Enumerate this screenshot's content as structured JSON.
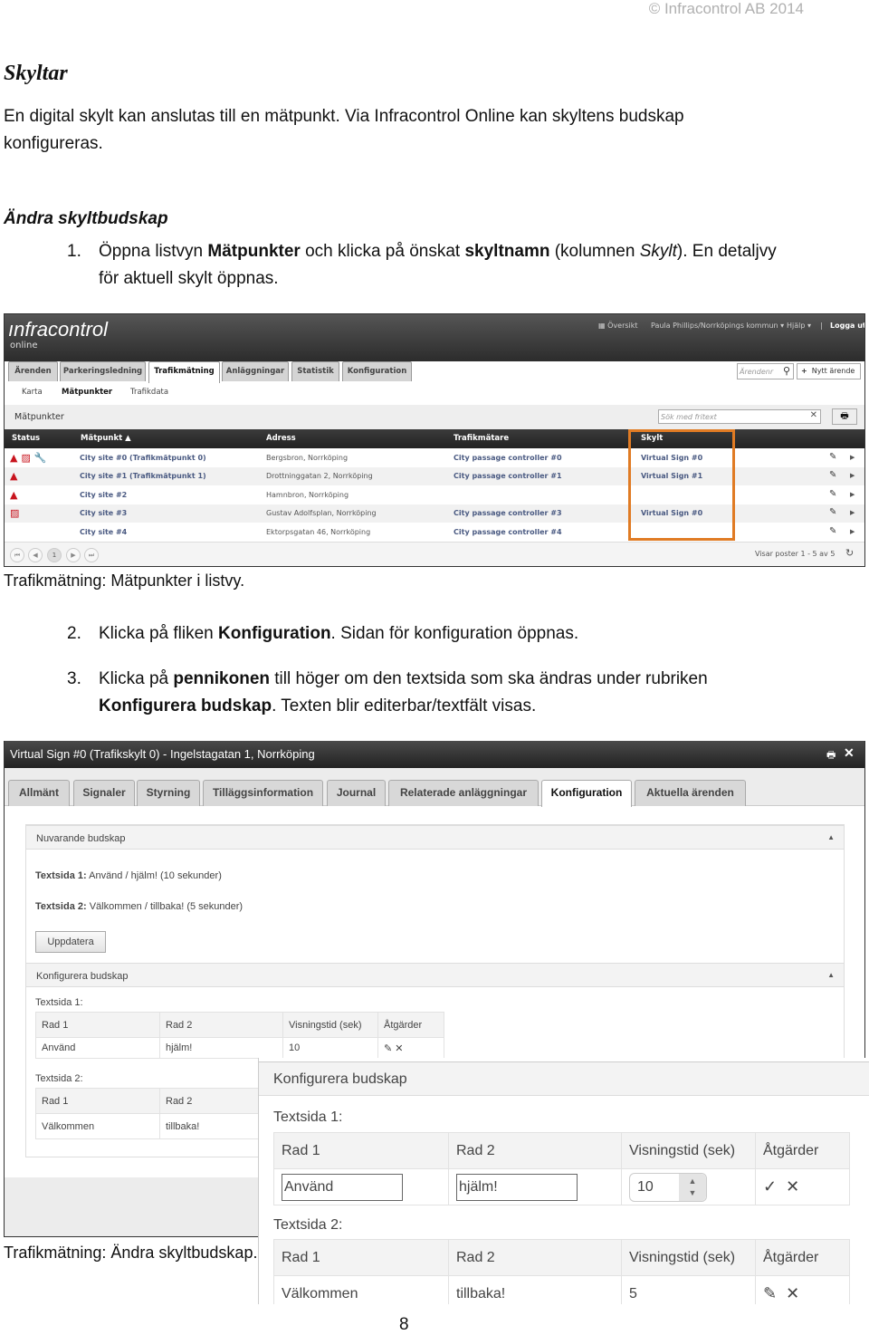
{
  "header": {
    "copyright": "© Infracontrol AB 2014"
  },
  "title": "Skyltar",
  "intro_1": "En digital skylt kan anslutas till en mätpunkt. Via Infracontrol Online kan skyltens budskap",
  "intro_2": "konfigureras.",
  "section_title": "Ändra skyltbudskap",
  "steps": [
    {
      "num": "1.",
      "a": "Öppna listvyn ",
      "b": "Mätpunkter",
      "c": " och klicka på önskat ",
      "d": "skyltnamn",
      "e": " (kolumnen ",
      "f": "Skylt",
      "g": "). En detaljvy",
      "line2": "för aktuell skylt öppnas."
    },
    {
      "num": "2.",
      "a": "Klicka på fliken ",
      "b": "Konfiguration",
      "c": ". Sidan för konfiguration öppnas."
    },
    {
      "num": "3.",
      "a": "Klicka på ",
      "b": "pennikonen",
      "c": " till höger om den textsida som ska ändras under rubriken",
      "d": "Konfigurera budskap",
      "e": ". Texten blir editerbar/textfält visas."
    }
  ],
  "caption_1": "Trafikmätning: Mätpunkter i listvy.",
  "caption_2": "Trafikmätning: Ändra skyltbudskap.",
  "page_number": "8",
  "app1": {
    "logo": "ınfracontrol",
    "logo_sub": "online",
    "top_links": {
      "overview": "Översikt",
      "user": "Paula Phillips/Norrköpings kommun ▾",
      "help": "Hjälp ▾",
      "sep": "|",
      "logout": "Logga ut"
    },
    "tabs": [
      "Ärenden",
      "Parkeringsledning",
      "Trafikmätning",
      "Anläggningar",
      "Statistik",
      "Konfiguration"
    ],
    "active_tab": "Trafikmätning",
    "case_search_placeholder": "Ärendenr",
    "new_case": "Nytt ärende",
    "subnav": [
      "Karta",
      "Mätpunkter",
      "Trafikdata"
    ],
    "panel_title": "Mätpunkter",
    "search_placeholder": "Sök med fritext",
    "columns": [
      "Status",
      "Mätpunkt ▲",
      "Adress",
      "Trafikmätare",
      "Skylt"
    ],
    "rows": [
      {
        "status": [
          "alarm",
          "fault",
          "service"
        ],
        "matpunkt": "City site #0 (Trafikmätpunkt 0)",
        "adress": "Bergsbron, Norrköping",
        "trafikmatare": "City passage controller #0",
        "skylt": "Virtual Sign #0"
      },
      {
        "status": [
          "alarm"
        ],
        "matpunkt": "City site #1 (Trafikmätpunkt 1)",
        "adress": "Drottninggatan 2, Norrköping",
        "trafikmatare": "City passage controller #1",
        "skylt": "Virtual Sign #1"
      },
      {
        "status": [
          "alarm"
        ],
        "matpunkt": "City site #2",
        "adress": "Hamnbron, Norrköping",
        "trafikmatare": "",
        "skylt": ""
      },
      {
        "status": [
          "fault"
        ],
        "matpunkt": "City site #3",
        "adress": "Gustav Adolfsplan, Norrköping",
        "trafikmatare": "City passage controller #3",
        "skylt": "Virtual Sign #0"
      },
      {
        "status": [],
        "matpunkt": "City site #4",
        "adress": "Ektorpsgatan 46, Norrköping",
        "trafikmatare": "City passage controller #4",
        "skylt": ""
      }
    ],
    "pager": {
      "first": "⏮",
      "prev": "◀",
      "page": "1",
      "next": "▶",
      "last": "⏭"
    },
    "records": "Visar poster 1 - 5 av 5",
    "highlight_color": "#e07b24"
  },
  "app2": {
    "title": "Virtual Sign #0 (Trafikskylt 0) - Ingelstagatan 1, Norrköping",
    "tabs": [
      "Allmänt",
      "Signaler",
      "Styrning",
      "Tilläggsinformation",
      "Journal",
      "Relaterade anläggningar",
      "Konfiguration",
      "Aktuella ärenden"
    ],
    "active_tab": "Konfiguration",
    "current_header": "Nuvarande budskap",
    "current": [
      {
        "label": "Textsida 1:",
        "text": "Använd / hjälm! (10 sekunder)"
      },
      {
        "label": "Textsida 2:",
        "text": "Välkommen / tillbaka! (5 sekunder)"
      }
    ],
    "update_button": "Uppdatera",
    "config_header": "Konfigurera budskap",
    "columns": [
      "Rad 1",
      "Rad 2",
      "Visningstid (sek)",
      "Åtgärder"
    ],
    "pages": [
      {
        "label": "Textsida 1:",
        "rad1": "Använd",
        "rad2": "hjälm!",
        "tid": "10"
      },
      {
        "label": "Textsida 2:",
        "rad1": "Välkommen",
        "rad2": "tillbaka!",
        "tid": "5"
      }
    ]
  }
}
